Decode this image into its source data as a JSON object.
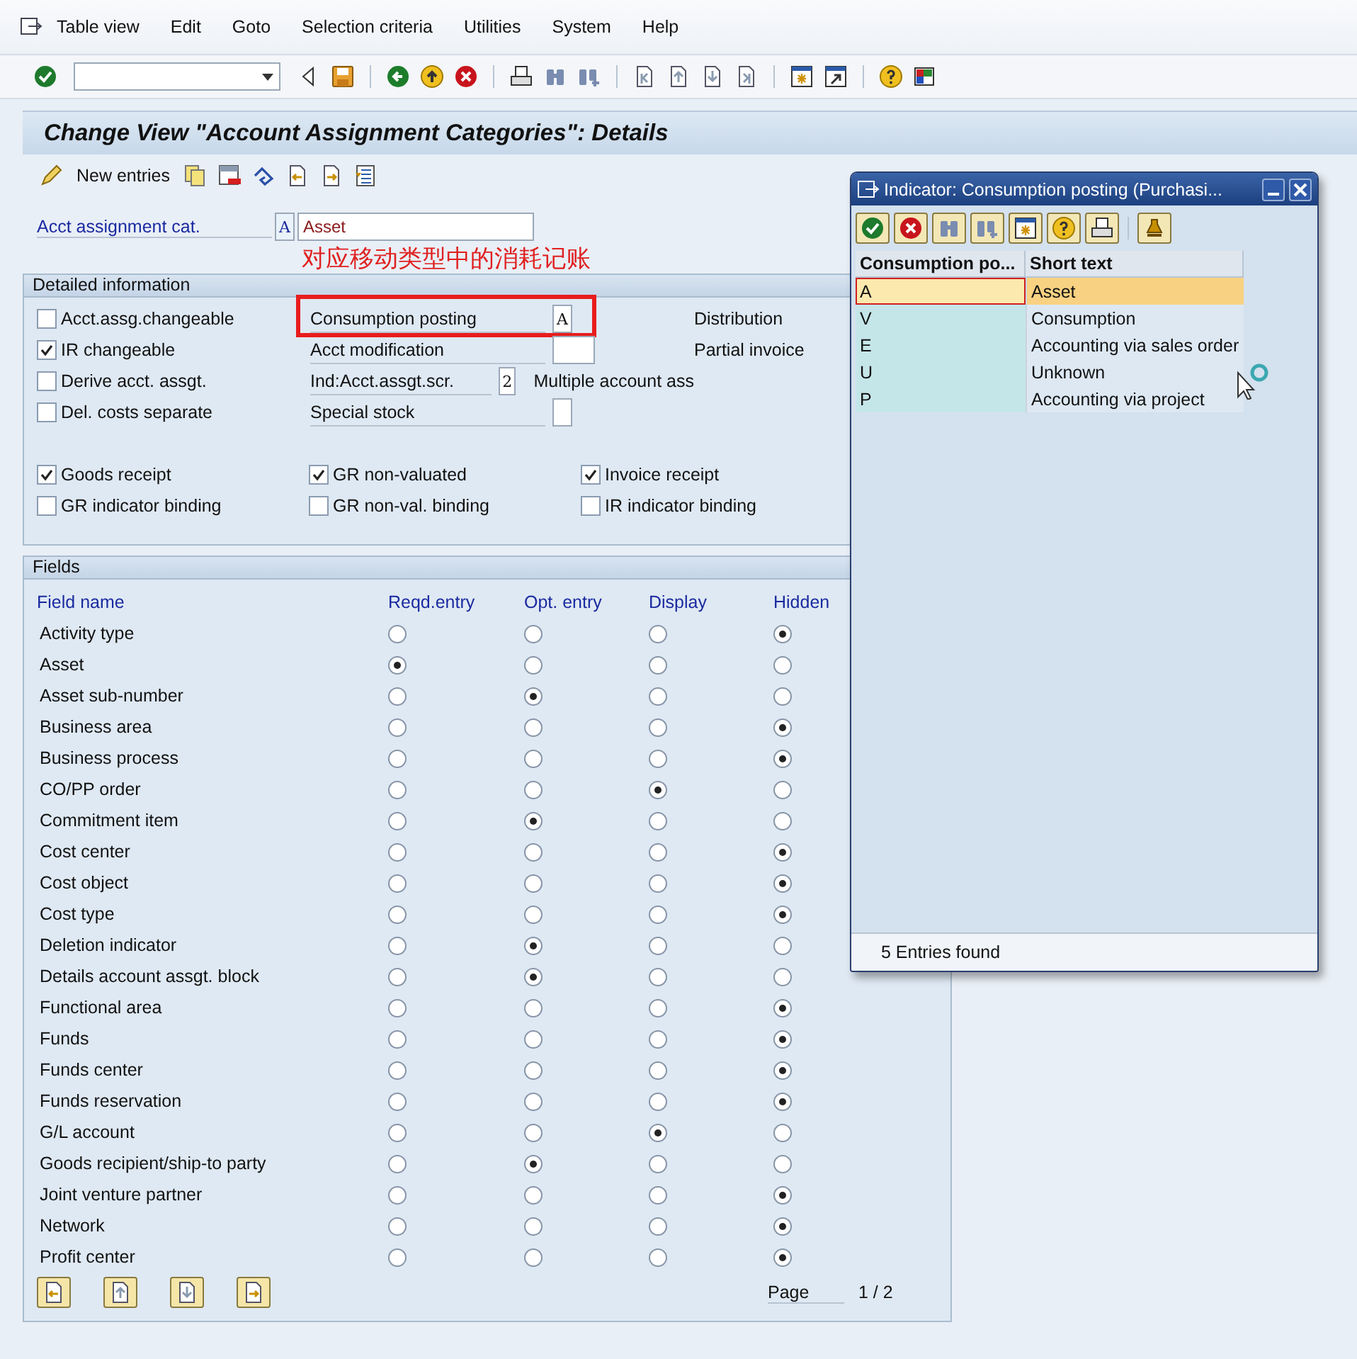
{
  "menu": [
    "Table view",
    "Edit",
    "Goto",
    "Selection criteria",
    "Utilities",
    "System",
    "Help"
  ],
  "title": "Change View \"Account Assignment Categories\": Details",
  "new_entries": "New entries",
  "key_field": {
    "label": "Acct assignment cat.",
    "value": "A",
    "description": "Asset"
  },
  "annotation": "对应移动类型中的消耗记账",
  "detailed": {
    "title": "Detailed information",
    "checks": [
      {
        "label": "Acct.assg.changeable",
        "checked": false
      },
      {
        "label": "IR changeable",
        "checked": true
      },
      {
        "label": "Derive acct. assgt.",
        "checked": false
      },
      {
        "label": "Del. costs separate",
        "checked": false
      }
    ],
    "fields": [
      {
        "label": "Consumption posting",
        "value": "A",
        "wide": false,
        "highlighted": true,
        "side": "Distribution"
      },
      {
        "label": "Acct modification",
        "wide": true,
        "highlighted": false,
        "side": "Partial invoice"
      },
      {
        "label": "Ind:Acct.assgt.scr.",
        "value": "2",
        "wide": false,
        "highlighted": false,
        "note": "Multiple account ass"
      },
      {
        "label": "Special stock",
        "wide": false,
        "highlighted": false
      }
    ],
    "bottom_checks": [
      {
        "label": "Goods receipt",
        "checked": true
      },
      {
        "label": "GR non-valuated",
        "checked": true
      },
      {
        "label": "Invoice receipt",
        "checked": true
      },
      {
        "label": "GR indicator binding",
        "checked": false
      },
      {
        "label": "GR non-val. binding",
        "checked": false
      },
      {
        "label": "IR indicator binding",
        "checked": false
      }
    ]
  },
  "fields": {
    "title": "Fields",
    "columns": [
      "Field name",
      "Reqd.entry",
      "Opt. entry",
      "Display",
      "Hidden"
    ],
    "rows": [
      {
        "name": "Activity type",
        "options": [
          {
            "selected": false
          },
          {
            "selected": false
          },
          {
            "selected": false
          },
          {
            "selected": true
          }
        ]
      },
      {
        "name": "Asset",
        "options": [
          {
            "selected": true
          },
          {
            "selected": false
          },
          {
            "selected": false
          },
          {
            "selected": false
          }
        ]
      },
      {
        "name": "Asset sub-number",
        "options": [
          {
            "selected": false
          },
          {
            "selected": true
          },
          {
            "selected": false
          },
          {
            "selected": false
          }
        ]
      },
      {
        "name": "Business area",
        "options": [
          {
            "selected": false
          },
          {
            "selected": false
          },
          {
            "selected": false
          },
          {
            "selected": true
          }
        ]
      },
      {
        "name": "Business process",
        "options": [
          {
            "selected": false
          },
          {
            "selected": false
          },
          {
            "selected": false
          },
          {
            "selected": true
          }
        ]
      },
      {
        "name": "CO/PP order",
        "options": [
          {
            "selected": false
          },
          {
            "selected": false
          },
          {
            "selected": true
          },
          {
            "selected": false
          }
        ]
      },
      {
        "name": "Commitment item",
        "options": [
          {
            "selected": false
          },
          {
            "selected": true
          },
          {
            "selected": false
          },
          {
            "selected": false
          }
        ]
      },
      {
        "name": "Cost center",
        "options": [
          {
            "selected": false
          },
          {
            "selected": false
          },
          {
            "selected": false
          },
          {
            "selected": true
          }
        ]
      },
      {
        "name": "Cost object",
        "options": [
          {
            "selected": false
          },
          {
            "selected": false
          },
          {
            "selected": false
          },
          {
            "selected": true
          }
        ]
      },
      {
        "name": "Cost type",
        "options": [
          {
            "selected": false
          },
          {
            "selected": false
          },
          {
            "selected": false
          },
          {
            "selected": true
          }
        ]
      },
      {
        "name": "Deletion indicator",
        "options": [
          {
            "selected": false
          },
          {
            "selected": true
          },
          {
            "selected": false
          },
          {
            "selected": false
          }
        ]
      },
      {
        "name": "Details account assgt. block",
        "options": [
          {
            "selected": false
          },
          {
            "selected": true
          },
          {
            "selected": false
          },
          {
            "selected": false
          }
        ]
      },
      {
        "name": "Functional area",
        "options": [
          {
            "selected": false
          },
          {
            "selected": false
          },
          {
            "selected": false
          },
          {
            "selected": true
          }
        ]
      },
      {
        "name": "Funds",
        "options": [
          {
            "selected": false
          },
          {
            "selected": false
          },
          {
            "selected": false
          },
          {
            "selected": true
          }
        ]
      },
      {
        "name": "Funds center",
        "options": [
          {
            "selected": false
          },
          {
            "selected": false
          },
          {
            "selected": false
          },
          {
            "selected": true
          }
        ]
      },
      {
        "name": "Funds reservation",
        "options": [
          {
            "selected": false
          },
          {
            "selected": false
          },
          {
            "selected": false
          },
          {
            "selected": true
          }
        ]
      },
      {
        "name": "G/L account",
        "options": [
          {
            "selected": false
          },
          {
            "selected": false
          },
          {
            "selected": true
          },
          {
            "selected": false
          }
        ]
      },
      {
        "name": "Goods recipient/ship-to party",
        "options": [
          {
            "selected": false
          },
          {
            "selected": true
          },
          {
            "selected": false
          },
          {
            "selected": false
          }
        ]
      },
      {
        "name": "Joint venture partner",
        "options": [
          {
            "selected": false
          },
          {
            "selected": false
          },
          {
            "selected": false
          },
          {
            "selected": true
          }
        ]
      },
      {
        "name": "Network",
        "options": [
          {
            "selected": false
          },
          {
            "selected": false
          },
          {
            "selected": false
          },
          {
            "selected": true
          }
        ]
      },
      {
        "name": "Profit center",
        "options": [
          {
            "selected": false
          },
          {
            "selected": false
          },
          {
            "selected": false
          },
          {
            "selected": true
          }
        ]
      }
    ],
    "page_label": "Page",
    "page": "1 / 2"
  },
  "popup": {
    "title": "Indicator: Consumption posting (Purchasi...",
    "columns": [
      "Consumption po...",
      "Short text"
    ],
    "rows": [
      {
        "key": "A",
        "text": "Asset",
        "selected": true
      },
      {
        "key": "V",
        "text": "Consumption",
        "selected": false
      },
      {
        "key": "E",
        "text": "Accounting via sales order",
        "selected": false
      },
      {
        "key": "U",
        "text": "Unknown",
        "selected": false
      },
      {
        "key": "P",
        "text": "Accounting via project",
        "selected": false
      }
    ],
    "status": "5 Entries found"
  }
}
